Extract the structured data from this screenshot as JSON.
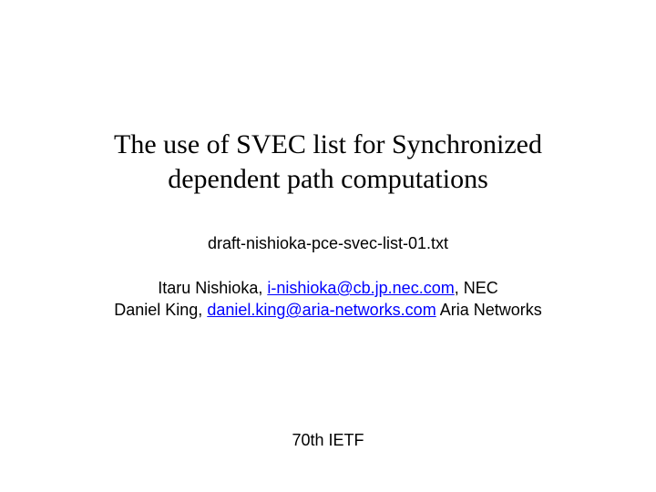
{
  "title_line1": "The use of SVEC list for Synchronized",
  "title_line2": "dependent path computations",
  "draft": "draft-nishioka-pce-svec-list-01.txt",
  "authors": {
    "a1_name": "Itaru Nishioka,  ",
    "a1_email": "i-nishioka@cb.jp.nec.com",
    "a1_aff": ", NEC",
    "a2_name": "Daniel King, ",
    "a2_email": "daniel.king@aria-networks.com",
    "a2_aff": "   Aria Networks"
  },
  "footer": "70th IETF"
}
